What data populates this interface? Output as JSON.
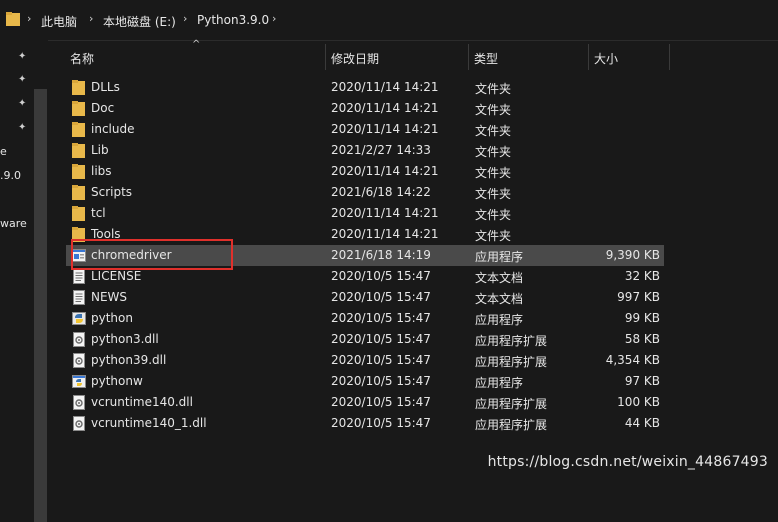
{
  "address": {
    "crumbs": [
      "此电脑",
      "本地磁盘 (E:)",
      "Python3.9.0"
    ],
    "separator": "›"
  },
  "left_pane": {
    "labels": [
      "e",
      ".9.0",
      "ware"
    ],
    "pin_icon": "pin-icon"
  },
  "columns": {
    "name": "名称",
    "date": "修改日期",
    "type": "类型",
    "size": "大小"
  },
  "files": [
    {
      "name": "DLLs",
      "date": "2020/11/14 14:21",
      "type": "文件夹",
      "size": "",
      "icon": "folder"
    },
    {
      "name": "Doc",
      "date": "2020/11/14 14:21",
      "type": "文件夹",
      "size": "",
      "icon": "folder"
    },
    {
      "name": "include",
      "date": "2020/11/14 14:21",
      "type": "文件夹",
      "size": "",
      "icon": "folder"
    },
    {
      "name": "Lib",
      "date": "2021/2/27 14:33",
      "type": "文件夹",
      "size": "",
      "icon": "folder"
    },
    {
      "name": "libs",
      "date": "2020/11/14 14:21",
      "type": "文件夹",
      "size": "",
      "icon": "folder"
    },
    {
      "name": "Scripts",
      "date": "2021/6/18 14:22",
      "type": "文件夹",
      "size": "",
      "icon": "folder"
    },
    {
      "name": "tcl",
      "date": "2020/11/14 14:21",
      "type": "文件夹",
      "size": "",
      "icon": "folder"
    },
    {
      "name": "Tools",
      "date": "2020/11/14 14:21",
      "type": "文件夹",
      "size": "",
      "icon": "folder"
    },
    {
      "name": "chromedriver",
      "date": "2021/6/18 14:19",
      "type": "应用程序",
      "size": "9,390 KB",
      "icon": "exe",
      "selected": true
    },
    {
      "name": "LICENSE",
      "date": "2020/10/5 15:47",
      "type": "文本文档",
      "size": "32 KB",
      "icon": "text"
    },
    {
      "name": "NEWS",
      "date": "2020/10/5 15:47",
      "type": "文本文档",
      "size": "997 KB",
      "icon": "text"
    },
    {
      "name": "python",
      "date": "2020/10/5 15:47",
      "type": "应用程序",
      "size": "99 KB",
      "icon": "python"
    },
    {
      "name": "python3.dll",
      "date": "2020/10/5 15:47",
      "type": "应用程序扩展",
      "size": "58 KB",
      "icon": "dll"
    },
    {
      "name": "python39.dll",
      "date": "2020/10/5 15:47",
      "type": "应用程序扩展",
      "size": "4,354 KB",
      "icon": "dll"
    },
    {
      "name": "pythonw",
      "date": "2020/10/5 15:47",
      "type": "应用程序",
      "size": "97 KB",
      "icon": "pythonw"
    },
    {
      "name": "vcruntime140.dll",
      "date": "2020/10/5 15:47",
      "type": "应用程序扩展",
      "size": "100 KB",
      "icon": "dll"
    },
    {
      "name": "vcruntime140_1.dll",
      "date": "2020/10/5 15:47",
      "type": "应用程序扩展",
      "size": "44 KB",
      "icon": "dll"
    }
  ],
  "watermark": "https://blog.csdn.net/weixin_44867493",
  "colors": {
    "folder": "#e8b84a",
    "highlight": "#e0302b",
    "selection": "#4a4a4a"
  }
}
